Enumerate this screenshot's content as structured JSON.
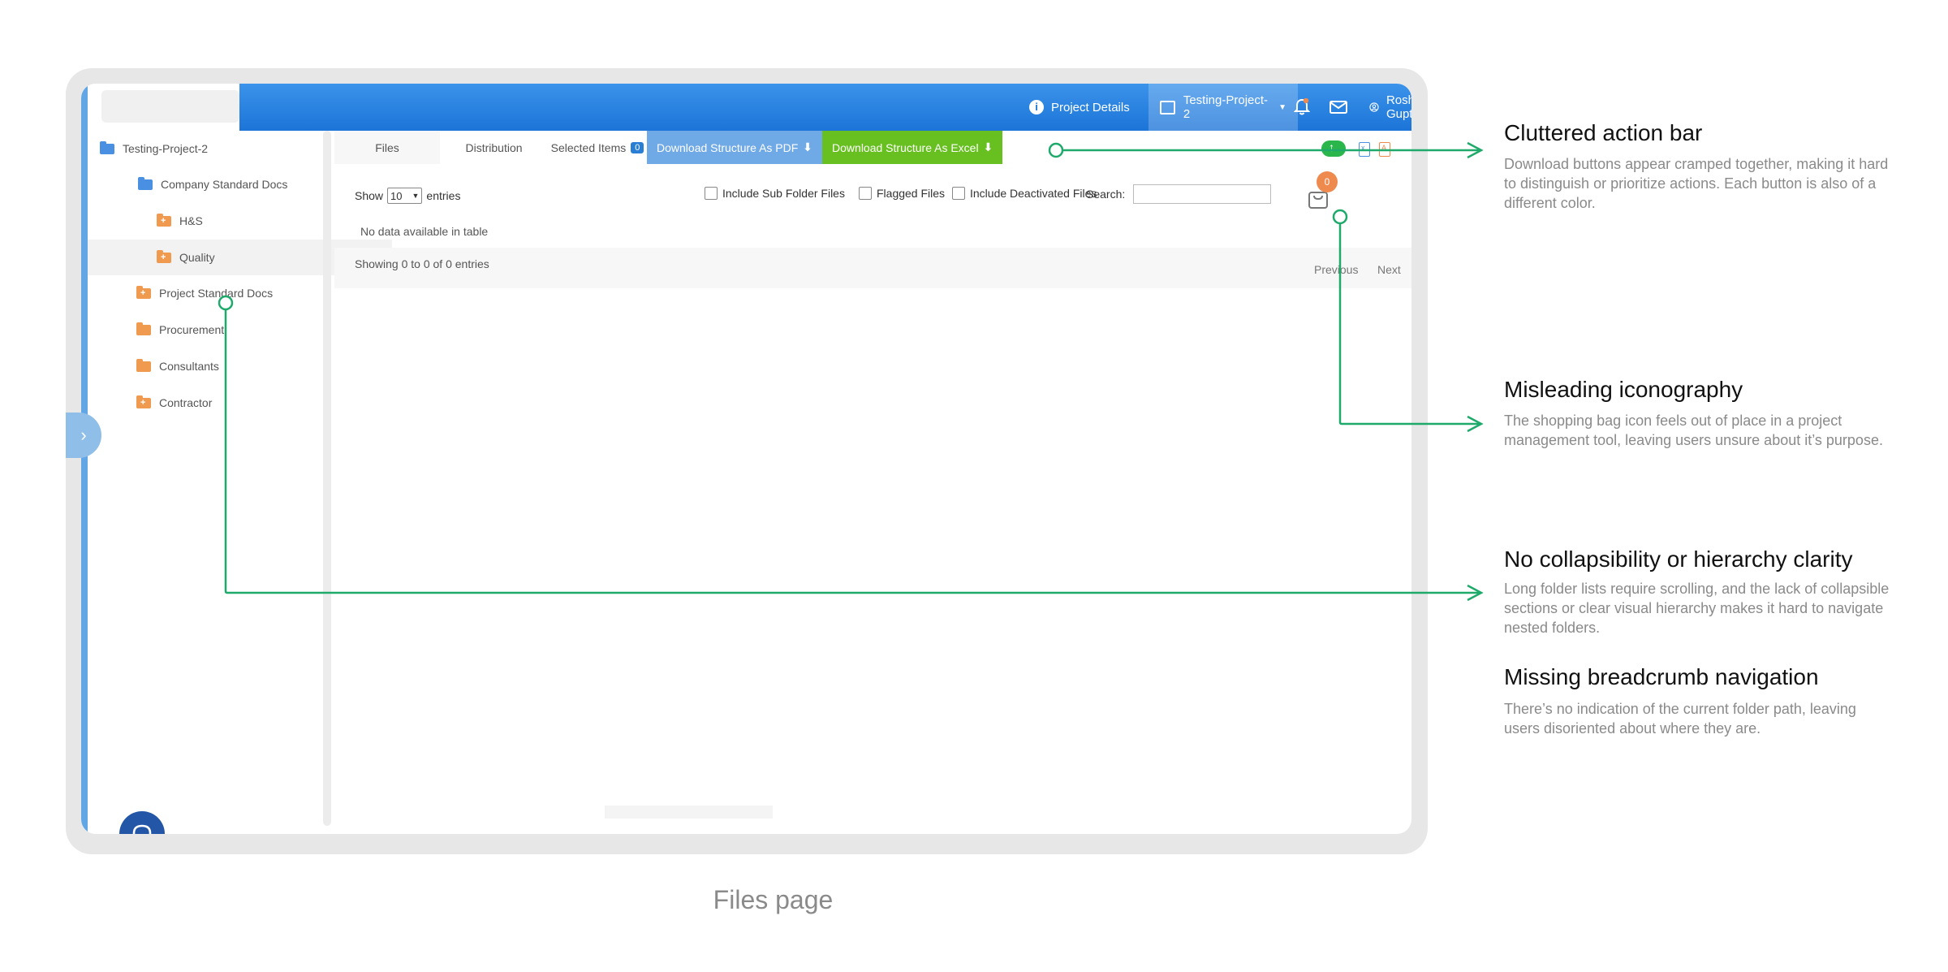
{
  "topbar": {
    "project_details": "Project Details",
    "project_selector": "Testing-Project-2",
    "user_name": "Roshni Gupta"
  },
  "tree": {
    "items": [
      {
        "label": "Testing-Project-2"
      },
      {
        "label": "Company Standard Docs"
      },
      {
        "label": "H&S"
      },
      {
        "label": "Quality"
      },
      {
        "label": "Project Standard Docs"
      },
      {
        "label": "Procurement"
      },
      {
        "label": "Consultants"
      },
      {
        "label": "Contractor"
      }
    ]
  },
  "tabs": {
    "files": "Files",
    "distribution": "Distribution",
    "selected_items": "Selected Items",
    "selected_count": "0",
    "download_pdf": "Download Structure As PDF",
    "download_excel": "Download Structure As Excel"
  },
  "controls": {
    "show": "Show",
    "entries_value": "10",
    "entries": "entries",
    "include_sub_folder": "Include Sub Folder Files",
    "flagged": "Flagged Files",
    "include_deactivated": "Include Deactivated Files",
    "search_label": "Search:",
    "bag_count": "0"
  },
  "table": {
    "empty": "No data available in table",
    "showing": "Showing 0 to 0 of 0 entries",
    "previous": "Previous",
    "next": "Next"
  },
  "annotations": [
    {
      "title": "Cluttered action bar",
      "body": "Download buttons appear cramped together, making it hard to distinguish or prioritize actions. Each button is also of a different color."
    },
    {
      "title": "Misleading iconography",
      "body": "The shopping bag icon feels out of place in a project management tool, leaving users unsure about it’s purpose."
    },
    {
      "title": "No collapsibility or hierarchy clarity",
      "body": "Long folder lists require scrolling, and the lack of collapsible sections or clear visual hierarchy makes it hard to navigate nested folders."
    },
    {
      "title": "Missing breadcrumb navigation",
      "body": "There’s no indication of the current folder path, leaving users disoriented about where they are."
    }
  ],
  "caption": "Files page",
  "colors": {
    "accent": "#1c74d8",
    "excel_green": "#67c01f",
    "annotation_line": "#1faa6b",
    "badge_orange": "#ef8a4f"
  }
}
